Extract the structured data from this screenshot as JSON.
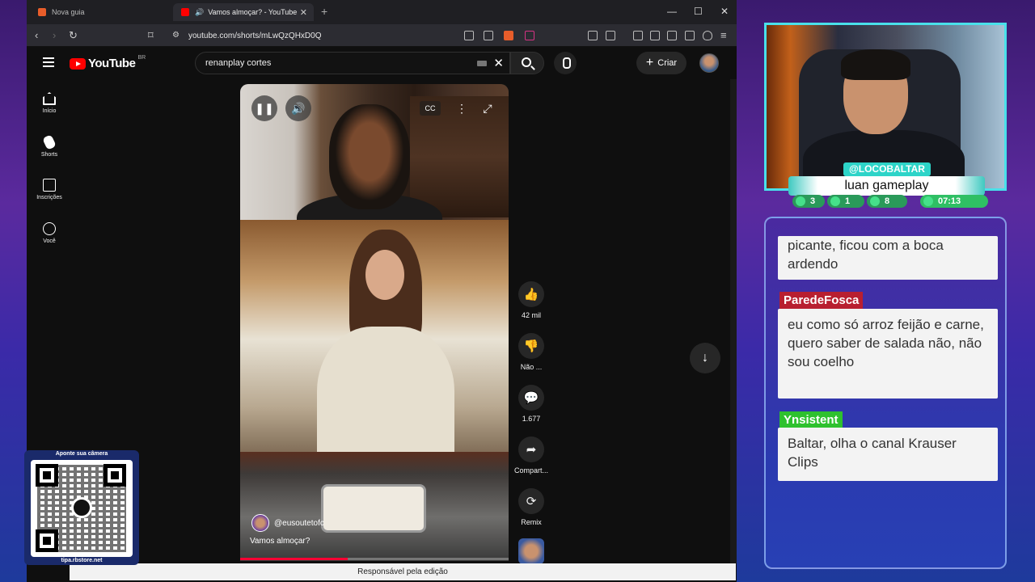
{
  "browser": {
    "tabs": [
      {
        "title": "Nova guia",
        "active": false
      },
      {
        "title": "Vamos almoçar? - YouTube",
        "active": true
      }
    ],
    "url": "youtube.com/shorts/mLwQzQHxD0Q"
  },
  "youtube": {
    "logo_text": "YouTube",
    "region": "BR",
    "search_query": "renanplay cortes",
    "create_label": "Criar",
    "sidebar": [
      {
        "label": "Início",
        "icon": "home-icon"
      },
      {
        "label": "Shorts",
        "icon": "shorts-icon"
      },
      {
        "label": "Inscrições",
        "icon": "subscriptions-icon"
      },
      {
        "label": "Você",
        "icon": "you-icon"
      }
    ],
    "short": {
      "channel": "@eusoutetofc",
      "title": "Vamos almoçar?",
      "progress_fraction": 0.4,
      "likes": "42 mil",
      "dislike_label": "Não ...",
      "comments": "1.677",
      "share_label": "Compart...",
      "remix_label": "Remix"
    }
  },
  "caption": "Responsável pela edição",
  "qr": {
    "top_label": "Aponte sua câmera",
    "bottom_label": "tipa.rbstore.net"
  },
  "stream": {
    "handle": "@LOCOBALTAR",
    "game": "luan gameplay",
    "stats": {
      "chat": "3",
      "views": "1",
      "subs": "8",
      "time": "07:13"
    }
  },
  "chat": [
    {
      "user": "",
      "text": "picante, ficou com a boca ardendo"
    },
    {
      "user": "ParedeFosca",
      "text": "eu como só arroz feijão e carne, quero saber de salada não, não sou coelho"
    },
    {
      "user": "Ynsistent",
      "text": "Baltar, olha o canal Krauser Clips"
    }
  ],
  "colors": {
    "yt_red": "#ff0000",
    "cam_border": "#49e0ea",
    "user_red": "#b81f30",
    "user_green": "#2ec12e"
  }
}
